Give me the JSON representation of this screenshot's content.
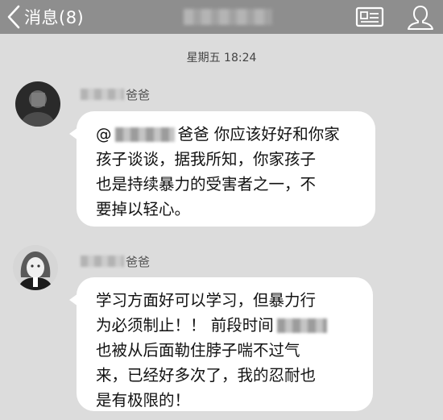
{
  "nav": {
    "back_label": "消息(8)",
    "back_icon": "chevron-left-icon",
    "card_icon": "contact-card-icon",
    "profile_icon": "user-profile-icon"
  },
  "chat": {
    "timestamp": "星期五 18:24",
    "messages": [
      {
        "sender_suffix": "爸爸",
        "lines": {
          "l1": {
            "prefix": "@",
            "suffix": "爸爸 你应该好好和你家"
          },
          "l2": "孩子谈谈，据我所知，你家孩子",
          "l3": "也是持续暴力的受害者之一，不",
          "l4": "要掉以轻心。"
        }
      },
      {
        "sender_suffix": "爸爸",
        "lines": {
          "l1": "学习方面好可以学习，但暴力行",
          "l2": {
            "prefix": "为必须制止！！ 前段时间",
            "suffix": ""
          },
          "l3": "也被从后面勒住脖子喘不过气",
          "l4": "来，已经好多次了，我的忍耐也",
          "l5": "是有极限的！"
        }
      }
    ]
  }
}
